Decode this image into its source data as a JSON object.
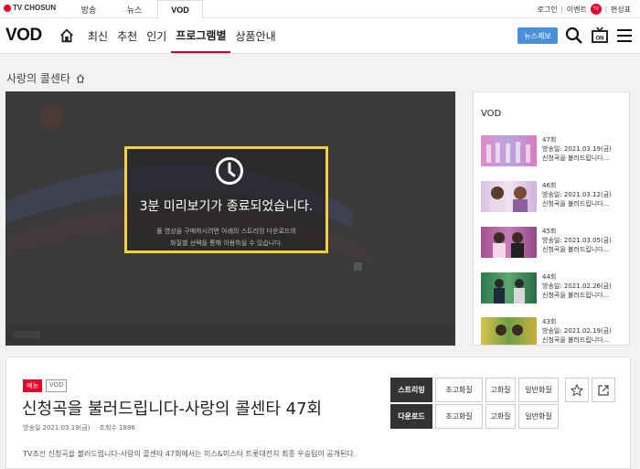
{
  "topbar": {
    "brand": "TV CHOSUN",
    "tabs": [
      {
        "label": "방송"
      },
      {
        "label": "뉴스"
      },
      {
        "label": "VOD"
      }
    ],
    "util": {
      "login": "로그인",
      "event": "이벤트",
      "event_badge": "TV",
      "schedule": "편성표"
    }
  },
  "nav": {
    "logo": "VOD",
    "menu": [
      {
        "label": "최신"
      },
      {
        "label": "추천"
      },
      {
        "label": "인기"
      },
      {
        "label": "프로그램별"
      },
      {
        "label": "상품안내"
      }
    ],
    "report_label": "뉴스제보"
  },
  "breadcrumb": {
    "title": "사랑의 콜센타"
  },
  "player": {
    "notice_title": "3분 미리보기가 종료되었습니다.",
    "notice_line1": "풀 영상을 구매하시려면 아래의 스트리밍 다운로드의",
    "notice_line2": "화질별 선택을 통해 이용하실 수 있습니다."
  },
  "sidebar": {
    "title": "VOD",
    "episodes": [
      {
        "num": "47회",
        "date": "방송일: 2021.03.19(금)",
        "title": "신청곡을 불러드립니다...",
        "thumb_color": "#c97ab8"
      },
      {
        "num": "46회",
        "date": "방송일: 2021.03.12(금)",
        "title": "신청곡을 불러드립니다...",
        "thumb_color": "#c9a0d0"
      },
      {
        "num": "45회",
        "date": "방송일: 2021.03.05(금)",
        "title": "신청곡을 불러드립니다...",
        "thumb_color": "#b06aa0"
      },
      {
        "num": "44회",
        "date": "방송일: 2021.02.26(금)",
        "title": "신청곡을 불러드립니다...",
        "thumb_color": "#3e8f5e"
      },
      {
        "num": "43회",
        "date": "방송일: 2021.02.19(금)",
        "title": "신청곡을 불러드립니다...",
        "thumb_color": "#7aa050"
      }
    ]
  },
  "info": {
    "badge_genre": "예능",
    "badge_type": "VOD",
    "title": "신청곡을 불러드립니다-사랑의 콜센타 47회",
    "air_date": "방송일 2021.03.19(금)",
    "views": "조회수 1886",
    "description": "TV조선 신청곡을 불러드립니다-사랑의 콜센타 47회에서는 미스&미스터 트롯대전치 최종 우승팀이 공개된다.",
    "streaming_label": "스트리밍",
    "download_label": "다운로드",
    "qualities": [
      "초고화질",
      "고화질",
      "일반화질"
    ]
  },
  "colors": {
    "accent_red": "#e5002d",
    "notice_border": "#f4d03f",
    "report_blue": "#4a90d9"
  }
}
